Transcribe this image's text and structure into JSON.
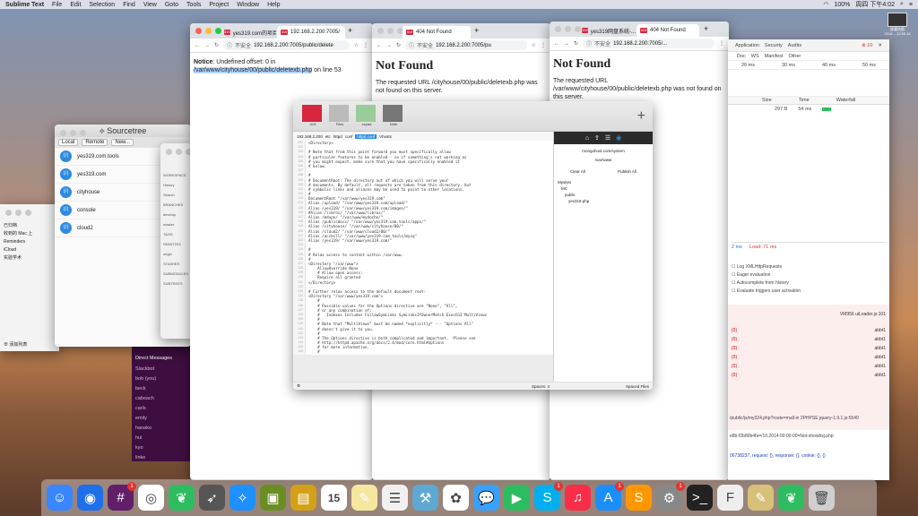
{
  "menubar": {
    "app": "Sublime Text",
    "items": [
      "File",
      "Edit",
      "Selection",
      "Find",
      "View",
      "Goto",
      "Tools",
      "Project",
      "Window",
      "Help"
    ],
    "status": [
      "100%",
      "周四 下午4:02"
    ]
  },
  "colors": {
    "chrome_tab": "#dee1e6",
    "slack_sidebar": "#3f0e40",
    "accent": "#2d8ae3",
    "favicon": "#d7263d"
  },
  "browser1": {
    "tabs": [
      {
        "label": "yes319.com的项目"
      },
      {
        "label": "192.168.2.200:7005/"
      }
    ],
    "security": "不安全",
    "url": "192.168.2.200:7005/public/delete",
    "notice_label": "Notice",
    "notice_text": ": Undefined offset: 0 in",
    "notice_path": "/var/www/cityhouse/00/public/deletexb.php",
    "notice_suffix": " on line 53"
  },
  "browser2": {
    "tabs": [
      {
        "label": "404 Not Found"
      }
    ],
    "security": "不安全",
    "url": "192.168.2.200:7005/pu",
    "heading": "Not Found",
    "body": "The requested URL /cityhouse/00/public/deletexb.php was not found on this server."
  },
  "browser3": {
    "tabs": [
      {
        "label": "yes319网盘系统-..."
      },
      {
        "label": "404 Not Found"
      }
    ],
    "security": "不安全",
    "url": "192.168.2.200:7005/...",
    "heading": "Not Found",
    "body": "The requested URL /var/www/cityhouse/00/public/deletexb.php was not found on this server."
  },
  "sourcetree": {
    "title": "Sourcetree",
    "segs": [
      "Local",
      "Remote",
      "New..."
    ],
    "repos": [
      "yes319.com.tools",
      "yes319.com",
      "cityhouse",
      "console",
      "cloud2"
    ]
  },
  "sidebar_window": {
    "items": [
      "WORKSPACE",
      "History",
      "Search",
      "BRANCHES",
      "develop",
      "master",
      "TAGS",
      "REMOTES",
      "origin",
      "STASHES",
      "SUBMODULES",
      "SUBTREES"
    ]
  },
  "wechat": {
    "items": [
      "已归档",
      "收到的 Mac 上",
      "Reminders",
      "iCloud",
      "实验学术"
    ],
    "footer": "添加列表"
  },
  "slack": {
    "section": "Direct Messages",
    "users": [
      "Slackbot",
      "bob (you)",
      "beck",
      "cabeach",
      "carls",
      "emily",
      "hanako",
      "hui",
      "kyo",
      "linke"
    ]
  },
  "finder": {
    "thumbs": [
      "319",
      "Files",
      "xxpad",
      "Note"
    ],
    "thumb_labels": [
      "319",
      "Files",
      "xxpad",
      "Note"
    ],
    "search1": "lt",
    "search2": "root",
    "path": [
      "192.168.2.200",
      "etc",
      "httpd",
      "conf",
      "httpd.conf",
      "Vhosts"
    ],
    "line_col": "Spaces: 4",
    "footer": "Spaced Files"
  },
  "right_panel": {
    "host": "mongohost.com/system",
    "user": "/var/www",
    "buttons": [
      "Clear All",
      "Publish All"
    ],
    "tree": [
      "Mysites",
      "MC",
      "public",
      "yes319.php"
    ]
  },
  "code_lines": [
    "<Directory>",
    "",
    "# Note that from this point forward you must specifically allow",
    "# particular features to be enabled - so if something's not working as",
    "# you might expect, make sure that you have specifically enabled it",
    "# below.",
    "",
    "#",
    "# DocumentRoot: The directory out of which you will serve your",
    "# documents. By default, all requests are taken from this directory, but",
    "# symbolic links and aliases may be used to point to other locations.",
    "#",
    "DocumentRoot \"/var/www/yes319.com\"",
    "Alias /upload/ \"/var/www/yes319.com/upload/\"",
    "Alias /yes319/ \"/var/www/yes319.com/images/\"",
    "#Alias /libros/ \"/var/www/libros/\"",
    "Alias /mdvpn/ \"/var/www/mydoche/\"",
    "Alias /publicdocs/ \"/var/www/yes319.com.tools/apps/\"",
    "Alias /cityhouse/ \"/var/www/cityhouse/00/\"",
    "Alias /cloud2/ \"/var/www/cloud2/00/\"",
    "Alias /accbill/ \"/var/www/yes319.com.tools/mysq\"",
    "Alias /yes319/ \"/var/www/yes319.com/\"",
    "",
    "#",
    "# Relax access to content within /var/www.",
    "#",
    "<Directory \"/var/www\">",
    "    AllowOverride None",
    "    # Allow open access:",
    "    Require all granted",
    "</Directory>",
    "",
    "# Further relax access to the default document root:",
    "<Directory \"/var/www/yes319.com\">",
    "    #",
    "    # Possible values for the Options directive are \"None\", \"All\",",
    "    # or any combination of:",
    "    #   Indexes Includes FollowSymLinks SymLinksIfOwnerMatch ExecCGI MultiViews",
    "    #",
    "    # Note that \"MultiViews\" must be named *explicitly* --- \"Options All\"",
    "    # doesn't give it to you.",
    "    #",
    "    # The Options directive is both complicated and important.  Please see",
    "    # http://httpd.apache.org/docs/2.4/mod/core.html#options",
    "    # for more information.",
    "    #"
  ],
  "devtools": {
    "tabs": [
      "Application",
      "Security",
      "Audits"
    ],
    "tools": [
      "Doc",
      "WS",
      "Manifest",
      "Other"
    ],
    "times": [
      "20 ms",
      "30 ms",
      "40 ms",
      "50 ms"
    ],
    "cols": [
      "Size",
      "Time",
      "Waterfall"
    ],
    "cell_size": "297 B",
    "cell_time": "54 ms",
    "summary_a": "2 ms",
    "summary_b": "Load: 71 ms",
    "console_items": [
      "Log XMLHttpRequests",
      "Eager evaluation",
      "Autocomplete from history",
      "Evaluate triggers user activation"
    ],
    "console_lines": [
      "VM956 uiLoader.js:101",
      "(0)",
      "(0)",
      "(0)",
      "(0)",
      "(0)",
      "(0)"
    ],
    "console_right": "abbt1",
    "long_line": "/public/js/my324.php?route=mall-in 2PHPSE jquery-1.9.1.js:5549",
    "long_line2": "e8b-f2b80b4fa=/10.2014:00:00:00=Not-showbsj.php",
    "req": "06738237, request: {}, response: {}, cookie: {}, {}"
  },
  "dock": {
    "apps": [
      "Finder",
      "Maps",
      "Slack",
      "Chrome",
      "Evernote",
      "Rocket",
      "Safari",
      "Preview",
      "Notes",
      "Calendar",
      "Notes2",
      "Reminders",
      "Xcode",
      "Photos",
      "Messages",
      "FaceTime",
      "Skype",
      "Music",
      "App Store",
      "Sublime",
      "System Preferences",
      "Terminal",
      "TextEdit",
      "Notes3",
      "Evernote2",
      "Trash"
    ],
    "calendar_day": "15",
    "badges": {
      "Slack": "1",
      "Skype": "1",
      "App Store": "1",
      "System Preferences": "1"
    }
  },
  "desktop": {
    "shot_label": "屏幕快照 2018-...12.55.16"
  }
}
